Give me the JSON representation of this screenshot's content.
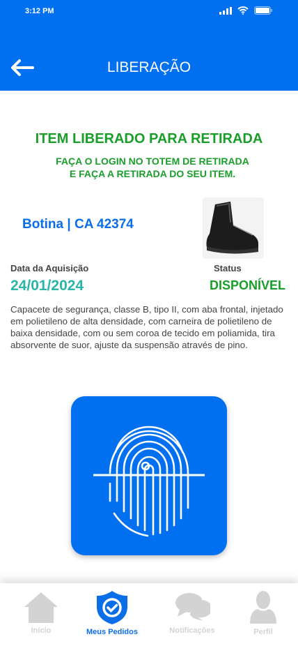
{
  "status_bar": {
    "time": "3:12 PM"
  },
  "header": {
    "title": "LIBERAÇÃO",
    "back_icon": "arrow-left-icon"
  },
  "message": {
    "title": "ITEM LIBERADO PARA RETIRADA",
    "line1": "FAÇA O LOGIN NO TOTEM DE RETIRADA",
    "line2": "E FAÇA A RETIRADA DO SEU ITEM."
  },
  "item": {
    "name": "Botina | CA 42374",
    "date_label": "Data da Aquisição",
    "date": "24/01/2024",
    "status_label": "Status",
    "status": "DISPONÍVEL",
    "description": "Capacete de segurança, classe B, tipo II, com aba frontal, injetado em polietileno de alta densidade, com carneira de polietileno de baixa densidade, com ou sem coroa de tecido em poliamida, tira absorvente de suor, ajuste da suspensão através de pino."
  },
  "nav": {
    "items": [
      {
        "label": "Início",
        "icon": "home-icon"
      },
      {
        "label": "Meus Pedidos",
        "icon": "shield-check-icon",
        "active": true
      },
      {
        "label": "Notificações",
        "icon": "chat-icon"
      },
      {
        "label": "Perfil",
        "icon": "user-icon"
      }
    ]
  },
  "colors": {
    "primary": "#0070F0",
    "success": "#1a9e2a",
    "date": "#2ab5a8",
    "inactive": "#d3d3d3"
  }
}
